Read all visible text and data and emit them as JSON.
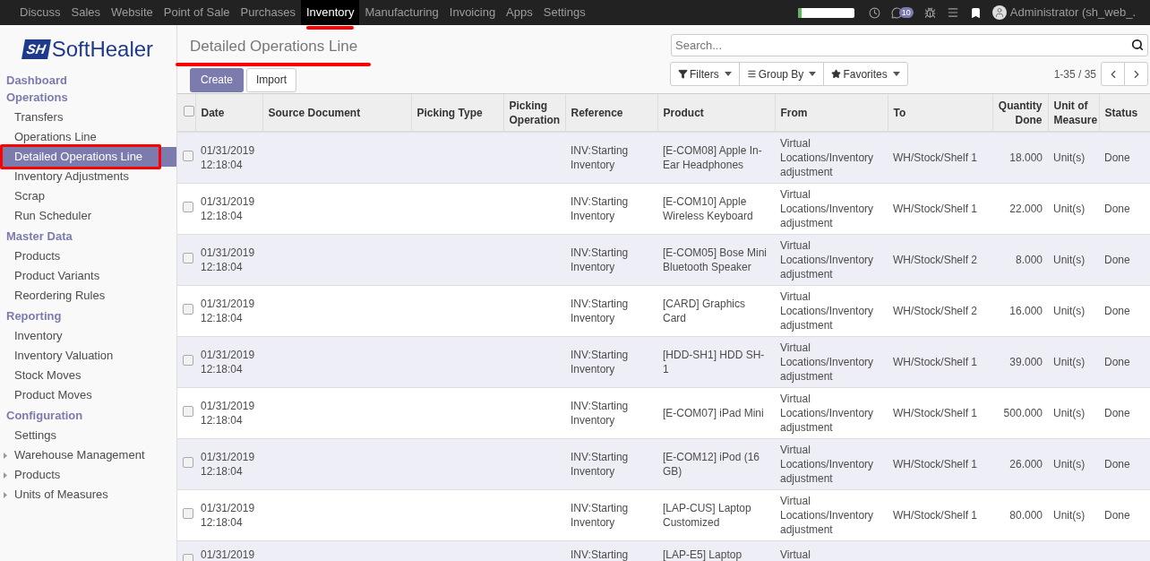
{
  "top_menu": [
    {
      "label": "Discuss",
      "selected": false
    },
    {
      "label": "Sales",
      "selected": false
    },
    {
      "label": "Website",
      "selected": false
    },
    {
      "label": "Point of Sale",
      "selected": false
    },
    {
      "label": "Purchases",
      "selected": false
    },
    {
      "label": "Inventory",
      "selected": true
    },
    {
      "label": "Manufacturing",
      "selected": false
    },
    {
      "label": "Invoicing",
      "selected": false
    },
    {
      "label": "Apps",
      "selected": false
    },
    {
      "label": "Settings",
      "selected": false
    }
  ],
  "systray": {
    "progress": {
      "level": 0.06
    },
    "messages_badge": "10",
    "user": "Administrator (sh_web_."
  },
  "logo": {
    "mark": "SH",
    "name": "SoftHealer"
  },
  "sidebar": [
    {
      "title": "Dashboard"
    },
    {
      "title": "Operations",
      "items": [
        {
          "label": "Transfers",
          "kind": "link",
          "selected": false
        },
        {
          "label": "Operations Line",
          "kind": "link",
          "selected": false
        },
        {
          "label": "Detailed Operations Line",
          "kind": "link",
          "selected": true
        },
        {
          "label": "Inventory Adjustments",
          "kind": "link",
          "selected": false
        },
        {
          "label": "Scrap",
          "kind": "link",
          "selected": false
        },
        {
          "label": "Run Scheduler",
          "kind": "link",
          "selected": false
        }
      ]
    },
    {
      "title": "Master Data",
      "items": [
        {
          "label": "Products",
          "kind": "link",
          "selected": false
        },
        {
          "label": "Product Variants",
          "kind": "link",
          "selected": false
        },
        {
          "label": "Reordering Rules",
          "kind": "link",
          "selected": false
        }
      ]
    },
    {
      "title": "Reporting",
      "items": [
        {
          "label": "Inventory",
          "kind": "link",
          "selected": false
        },
        {
          "label": "Inventory Valuation",
          "kind": "link",
          "selected": false
        },
        {
          "label": "Stock Moves",
          "kind": "link",
          "selected": false
        },
        {
          "label": "Product Moves",
          "kind": "link",
          "selected": false
        }
      ]
    },
    {
      "title": "Configuration",
      "items": [
        {
          "label": "Settings",
          "kind": "link",
          "selected": false
        },
        {
          "label": "Warehouse Management",
          "kind": "group",
          "expanded": false,
          "selected": false
        },
        {
          "label": "Products",
          "kind": "group",
          "expanded": false,
          "selected": false
        },
        {
          "label": "Units of Measures",
          "kind": "group",
          "expanded": false,
          "selected": false
        }
      ]
    }
  ],
  "title": "Detailed Operations Line",
  "buttons": {
    "create": "Create",
    "import": "Import"
  },
  "search": {
    "placeholder": "Search..."
  },
  "search_options": [
    "Filters",
    "Group By",
    "Favorites"
  ],
  "pager": "1-35 / 35",
  "table": {
    "select_all_checked": false,
    "columns": [
      "Date",
      "Source Document",
      "Picking Type",
      "Picking Operation",
      "Reference",
      "Product",
      "From",
      "To",
      "Quantity Done",
      "Unit of Measure",
      "Status"
    ],
    "rows": [
      {
        "date": "01/31/2019 12:18:04",
        "reference": "INV:Starting Inventory",
        "product": "[E-COM08] Apple In-Ear Headphones",
        "from": "Virtual Locations/Inventory adjustment",
        "to": "WH/Stock/Shelf 1",
        "quantity": "18.000",
        "uom": "Unit(s)",
        "status": "Done",
        "checked": false
      },
      {
        "date": "01/31/2019 12:18:04",
        "reference": "INV:Starting Inventory",
        "product": "[E-COM10] Apple Wireless Keyboard",
        "from": "Virtual Locations/Inventory adjustment",
        "to": "WH/Stock/Shelf 1",
        "quantity": "22.000",
        "uom": "Unit(s)",
        "status": "Done",
        "checked": false
      },
      {
        "date": "01/31/2019 12:18:04",
        "reference": "INV:Starting Inventory",
        "product": "[E-COM05] Bose Mini Bluetooth Speaker",
        "from": "Virtual Locations/Inventory adjustment",
        "to": "WH/Stock/Shelf 2",
        "quantity": "8.000",
        "uom": "Unit(s)",
        "status": "Done",
        "checked": false
      },
      {
        "date": "01/31/2019 12:18:04",
        "reference": "INV:Starting Inventory",
        "product": "[CARD] Graphics Card",
        "from": "Virtual Locations/Inventory adjustment",
        "to": "WH/Stock/Shelf 2",
        "quantity": "16.000",
        "uom": "Unit(s)",
        "status": "Done",
        "checked": false
      },
      {
        "date": "01/31/2019 12:18:04",
        "reference": "INV:Starting Inventory",
        "product": "[HDD-SH1] HDD SH-1",
        "from": "Virtual Locations/Inventory adjustment",
        "to": "WH/Stock/Shelf 1",
        "quantity": "39.000",
        "uom": "Unit(s)",
        "status": "Done",
        "checked": false
      },
      {
        "date": "01/31/2019 12:18:04",
        "reference": "INV:Starting Inventory",
        "product": "[E-COM07] iPad Mini",
        "from": "Virtual Locations/Inventory adjustment",
        "to": "WH/Stock/Shelf 1",
        "quantity": "500.000",
        "uom": "Unit(s)",
        "status": "Done",
        "checked": false
      },
      {
        "date": "01/31/2019 12:18:04",
        "reference": "INV:Starting Inventory",
        "product": "[E-COM12] iPod (16 GB)",
        "from": "Virtual Locations/Inventory adjustment",
        "to": "WH/Stock/Shelf 1",
        "quantity": "26.000",
        "uom": "Unit(s)",
        "status": "Done",
        "checked": false
      },
      {
        "date": "01/31/2019 12:18:04",
        "reference": "INV:Starting Inventory",
        "product": "[LAP-CUS] Laptop Customized",
        "from": "Virtual Locations/Inventory adjustment",
        "to": "WH/Stock/Shelf 1",
        "quantity": "80.000",
        "uom": "Unit(s)",
        "status": "Done",
        "checked": false
      },
      {
        "date": "01/31/2019",
        "reference": "INV:Starting",
        "product": "[LAP-E5] Laptop",
        "from": "Virtual",
        "checked": false
      }
    ]
  }
}
